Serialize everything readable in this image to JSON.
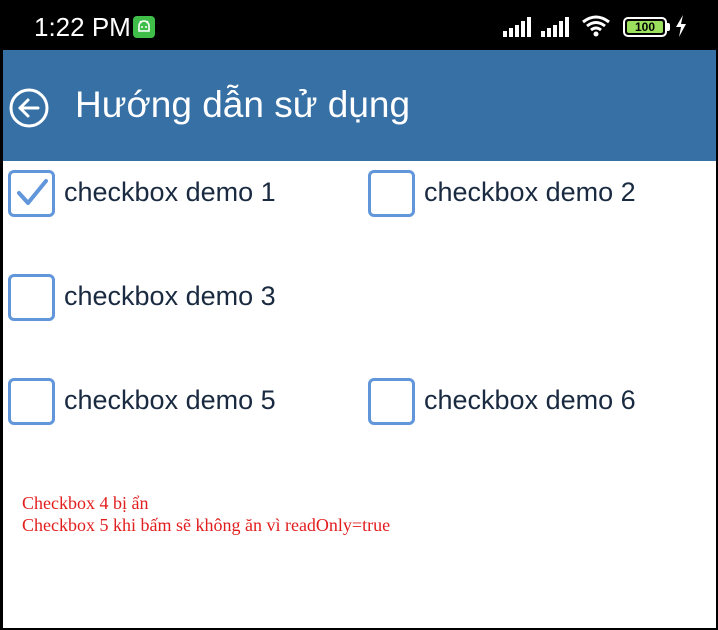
{
  "status_bar": {
    "time": "1:22 PM",
    "battery_level": "100",
    "icons": [
      "android-notification-icon",
      "signal-icon",
      "signal-icon",
      "wifi-icon",
      "battery-icon",
      "charging-icon"
    ]
  },
  "app_bar": {
    "title": "Hướng dẫn sử dụng",
    "back_icon": "back-arrow-icon",
    "background": "#3770a5"
  },
  "checkboxes": [
    {
      "label": "checkbox demo 1",
      "checked": true
    },
    {
      "label": "checkbox demo 2",
      "checked": false
    },
    {
      "label": "checkbox demo 3",
      "checked": false
    },
    {
      "label": "checkbox demo 5",
      "checked": false
    },
    {
      "label": "checkbox demo 6",
      "checked": false
    }
  ],
  "notes": {
    "line1": "Checkbox 4 bị ẩn",
    "line2": "Checkbox 5 khi bấm sẽ không ăn vì readOnly=true",
    "color": "#e21d1d"
  },
  "colors": {
    "checkbox_border": "#6196da"
  }
}
